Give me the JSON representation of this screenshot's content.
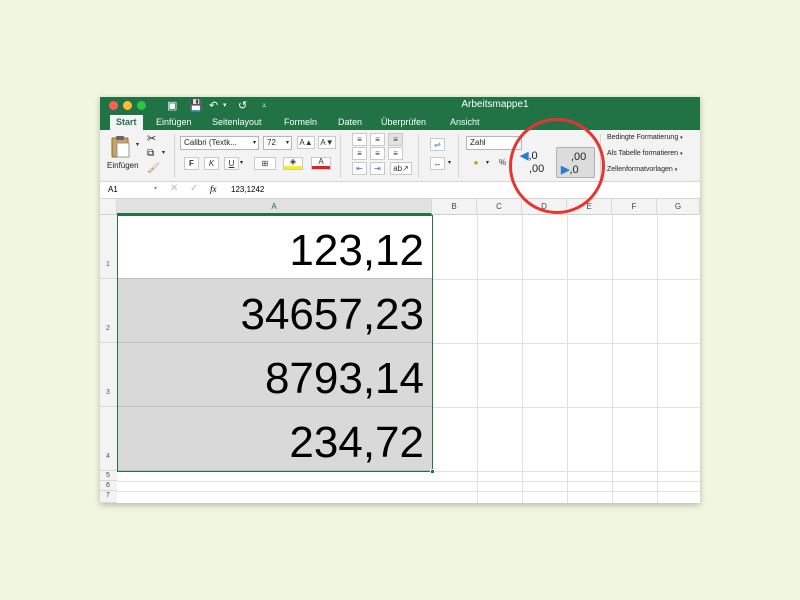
{
  "window": {
    "title": "Arbeitsmappe1"
  },
  "tabs": [
    "Start",
    "Einfügen",
    "Seitenlayout",
    "Formeln",
    "Daten",
    "Überprüfen",
    "Ansicht"
  ],
  "ribbon": {
    "paste_label": "Einfügen",
    "font_name": "Calibri (Textk...",
    "font_size": "72",
    "grow_font": "A▲",
    "shrink_font": "A▼",
    "bold": "F",
    "italic": "K",
    "underline": "U",
    "number_format": "Zahl",
    "percent": "%",
    "increase_decimal_top": ",0",
    "increase_decimal_bottom": ",00",
    "decrease_decimal_top": ",00",
    "decrease_decimal_bottom": ",0",
    "conditional_formatting": "Bedingte Formatierung",
    "format_as_table": "Als Tabelle formatieren",
    "cell_styles": "Zellenformatvorlagen"
  },
  "formula_bar": {
    "name_box": "A1",
    "fx": "fx",
    "value": "123,1242"
  },
  "columns": [
    "A",
    "B",
    "C",
    "D",
    "E",
    "F",
    "G"
  ],
  "rows": [
    "1",
    "2",
    "3",
    "4",
    "5",
    "6",
    "7"
  ],
  "cells": [
    "123,12",
    "34657,23",
    "8793,14",
    "234,72"
  ],
  "colors": {
    "excel_green": "#217346",
    "selection_fill": "#d9d9d9",
    "highlight_circle": "#e8332f",
    "background": "#f1f6de"
  }
}
